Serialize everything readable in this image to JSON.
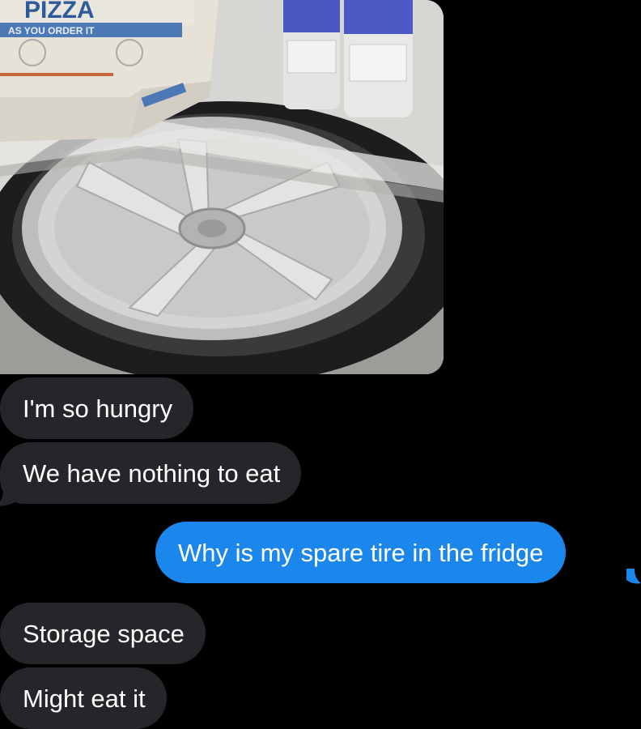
{
  "conversation": {
    "photo": {
      "box_label": "PIZZA",
      "box_subtext": "AS YOU ORDER IT"
    },
    "messages": [
      {
        "direction": "incoming",
        "text": "I'm so hungry"
      },
      {
        "direction": "incoming",
        "text": "We have nothing to eat"
      },
      {
        "direction": "outgoing",
        "text": "Why is my spare tire in the fridge"
      },
      {
        "direction": "incoming",
        "text": "Storage space"
      },
      {
        "direction": "incoming",
        "text": "Might eat it"
      }
    ]
  },
  "colors": {
    "background": "#000000",
    "incoming_bubble": "#26252a",
    "outgoing_bubble": "#1b87ec",
    "text": "#ffffff"
  }
}
